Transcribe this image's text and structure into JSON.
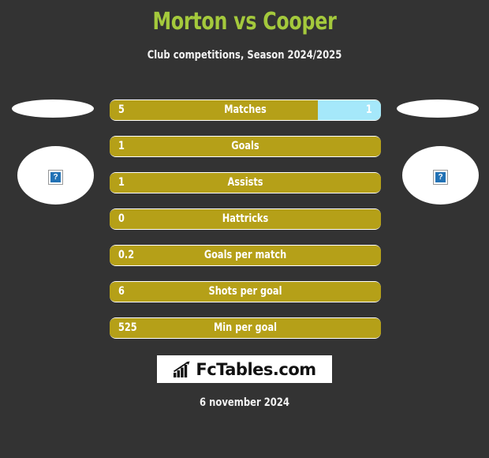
{
  "header": {
    "title": "Morton vs Cooper",
    "subtitle": "Club competitions, Season 2024/2025",
    "title_color": "#a4c93c",
    "subtitle_color": "#f2f2f2"
  },
  "theme": {
    "background": "#333333",
    "home_bar_color": "#b5a018",
    "away_bar_color": "#a5e8fa",
    "bar_text_color": "#ffffff"
  },
  "teams": {
    "home": {
      "crest_status": "broken-image",
      "crest_glyph": "?"
    },
    "away": {
      "crest_status": "broken-image",
      "crest_glyph": "?"
    }
  },
  "stats": [
    {
      "label": "Matches",
      "home": "5",
      "away": "1",
      "home_pct": 76.7,
      "away_pct": 23.3
    },
    {
      "label": "Goals",
      "home": "1",
      "away": "",
      "home_pct": 100,
      "away_pct": 0
    },
    {
      "label": "Assists",
      "home": "1",
      "away": "",
      "home_pct": 100,
      "away_pct": 0
    },
    {
      "label": "Hattricks",
      "home": "0",
      "away": "",
      "home_pct": 100,
      "away_pct": 0
    },
    {
      "label": "Goals per match",
      "home": "0.2",
      "away": "",
      "home_pct": 100,
      "away_pct": 0
    },
    {
      "label": "Shots per goal",
      "home": "6",
      "away": "",
      "home_pct": 100,
      "away_pct": 0
    },
    {
      "label": "Min per goal",
      "home": "525",
      "away": "",
      "home_pct": 100,
      "away_pct": 0
    }
  ],
  "footer": {
    "logo_text": "FcTables.com",
    "logo_icon": "bar-chart-trend-icon",
    "date": "6 november 2024"
  }
}
